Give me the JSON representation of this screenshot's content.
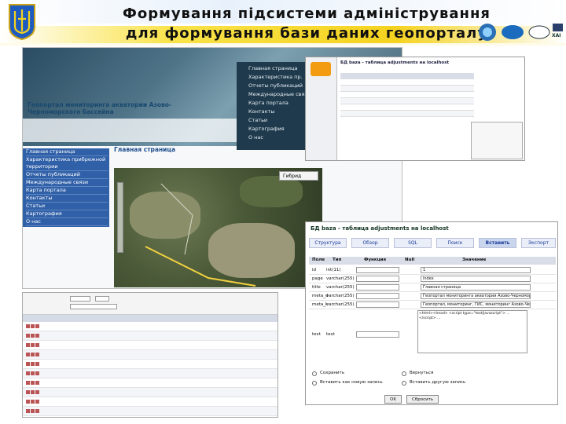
{
  "slide": {
    "title_line1": "Формування   підсистеми   адміністрування",
    "title_line2": "для  формування  бази  даних  геопорталу",
    "logo_labels": [
      "ХАІ"
    ]
  },
  "site": {
    "portal_name": "Геопортал мониторинга акватории Азово-Черноморского бассейна",
    "top_menu": [
      "Главная страница",
      "Характеристика пр.",
      "Отчеты публикаций",
      "Международные связи",
      "Карта портала",
      "Контакты",
      "Статьи",
      "Картография",
      "О нас"
    ],
    "left_nav": [
      "Главная страница",
      "Характеристика прибрежной территории",
      "Отчеты публикаций",
      "Международные связи",
      "Карта портала",
      "Контакты",
      "Статьи",
      "Картография",
      "О нас"
    ],
    "page_title": "Главная страница",
    "map_button": "Гибрид"
  },
  "pma_list": {
    "title": "БД baza - таблица adjustments на localhost"
  },
  "pma_edit": {
    "title": "БД baza - таблица adjustments на localhost",
    "tabs": [
      "Структура",
      "Обзор",
      "SQL",
      "Поиск",
      "Вставить",
      "Экспорт"
    ],
    "columns": [
      "Поле",
      "Тип",
      "Функция",
      "Null",
      "Значение"
    ],
    "rows": [
      {
        "field": "id",
        "type": "int(11)",
        "value": "1"
      },
      {
        "field": "page",
        "type": "varchar(255)",
        "value": "index"
      },
      {
        "field": "title",
        "type": "varchar(255)",
        "value": "Главная страница"
      },
      {
        "field": "meta_d",
        "type": "varchar(255)",
        "value": "Геопортал мониторинга акватории Азово-Черноморского бассейна"
      },
      {
        "field": "meta_k",
        "type": "varchar(255)",
        "value": "Геопортал, мониторинг, ГИС, мониторинг Азово-Черноморского бассейна"
      },
      {
        "field": "text",
        "type": "text",
        "value": ""
      }
    ],
    "text_value": "<html><head> <script type=\"text/javascript\"> ... </script> ...",
    "option_save": "Сохранить",
    "option_save_new": "Вставить как новую запись",
    "option_back": "Вернуться",
    "option_insert": "Вставить другую запись",
    "btn_ok": "OK",
    "btn_reset": "Сбросить"
  },
  "colors": {
    "nav_blue": "#3060a8",
    "banner_dark": "#1f3a4d",
    "flag_yellow": "#f4d21f"
  }
}
